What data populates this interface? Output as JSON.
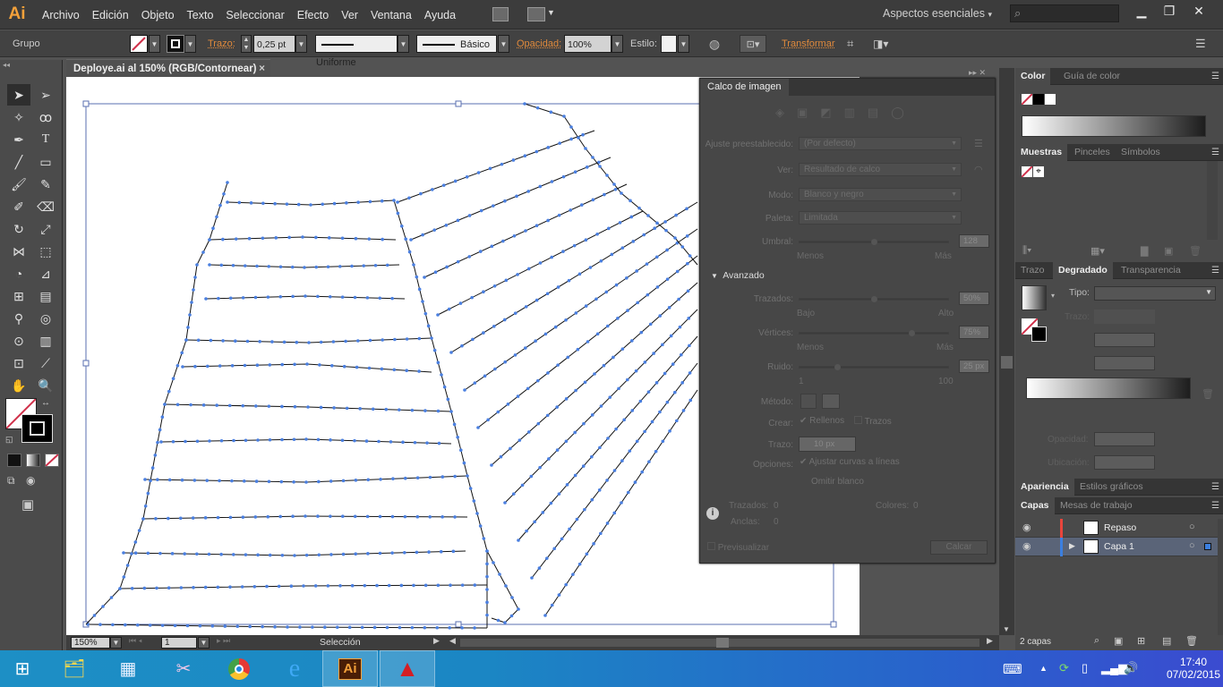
{
  "app": {
    "logo": "Ai",
    "window_title": "Deploye.ai al 150% (RGB/Contornear)"
  },
  "menu": [
    "Archivo",
    "Edición",
    "Objeto",
    "Texto",
    "Seleccionar",
    "Efecto",
    "Ver",
    "Ventana",
    "Ayuda"
  ],
  "workspace": {
    "label": "Aspectos esenciales",
    "search_icon": "⌕"
  },
  "window_controls": {
    "minimize": "▁",
    "restore": "❐",
    "close": "✕"
  },
  "control_bar": {
    "selection_type": "Grupo",
    "stroke_label": "Trazo:",
    "stroke_weight": "0,25 pt",
    "profile_uniform": "Uniforme",
    "brush_basic": "Básico",
    "opacity_label": "Opacidad:",
    "opacity_value": "100%",
    "style_label": "Estilo:",
    "transform_label": "Transformar"
  },
  "document_tab": {
    "title": "Deploye.ai al 150% (RGB/Contornear)",
    "close": "×"
  },
  "status_bar": {
    "zoom": "150%",
    "artboard": "1",
    "tool": "Selección"
  },
  "image_trace": {
    "title": "Calco de imagen",
    "preset_label": "Ajuste preestablecido:",
    "preset_value": "(Por defecto)",
    "view_label": "Ver:",
    "view_value": "Resultado de calco",
    "mode_label": "Modo:",
    "mode_value": "Blanco y negro",
    "palette_label": "Paleta:",
    "palette_value": "Limitada",
    "threshold_label": "Umbral:",
    "threshold_value": "128",
    "threshold_min": "Menos",
    "threshold_max": "Más",
    "threshold_fraction": 0.5,
    "advanced_label": "Avanzado",
    "paths_label": "Trazados:",
    "paths_value": "50%",
    "paths_fraction": 0.5,
    "paths_min": "Bajo",
    "paths_max": "Alto",
    "corners_label": "Vértices:",
    "corners_value": "75%",
    "corners_fraction": 0.75,
    "corners_min": "Menos",
    "corners_max": "Más",
    "noise_label": "Ruido:",
    "noise_value": "25 px",
    "noise_fraction": 0.25,
    "noise_min": "1",
    "noise_max": "100",
    "method_label": "Método:",
    "create_label": "Crear:",
    "fills_label": "Rellenos",
    "fills_checked": true,
    "strokes_label": "Trazos",
    "strokes_checked": false,
    "stroke_label": "Trazo:",
    "stroke_value": "10 px",
    "options_label": "Opciones:",
    "snap_label": "Ajustar curvas a líneas",
    "snap_checked": true,
    "ignore_white_label": "Omitir blanco",
    "paths_count_label": "Trazados:",
    "paths_count": "0",
    "colors_count_label": "Colores:",
    "colors_count": "0",
    "anchors_count_label": "Anclas:",
    "anchors_count": "0",
    "preview_label": "Previsualizar",
    "trace_button": "Calcar"
  },
  "right_panels": {
    "color_tabs": [
      "Color",
      "Guía de color"
    ],
    "swatches_tabs": [
      "Muestras",
      "Pinceles",
      "Símbolos"
    ],
    "gradient_tabs": [
      "Trazo",
      "Degradado",
      "Transparencia"
    ],
    "gradient": {
      "type_label": "Tipo:",
      "stroke_label": "Trazo:",
      "opacity_label": "Opacidad:",
      "location_label": "Ubicación:"
    },
    "appearance_tabs": [
      "Apariencia",
      "Estilos gráficos"
    ],
    "layers_tabs": [
      "Capas",
      "Mesas de trabajo"
    ],
    "layers": [
      {
        "name": "Repaso",
        "color": "#e8453c",
        "selected": false,
        "expandable": false
      },
      {
        "name": "Capa 1",
        "color": "#3b7fe0",
        "selected": true,
        "expandable": true
      }
    ],
    "layers_count": "2 capas"
  },
  "taskbar": {
    "apps": [
      "windows-start",
      "file-explorer",
      "calculator",
      "snipping-tool",
      "chrome",
      "internet-explorer",
      "illustrator",
      "autocad"
    ],
    "illustrator_label": "Ai",
    "time": "17:40",
    "date": "07/02/2015"
  },
  "colors": {
    "accent_orange": "#f4a13a",
    "trace_blue": "#4a7fe0",
    "artboard": "#ffffff"
  }
}
